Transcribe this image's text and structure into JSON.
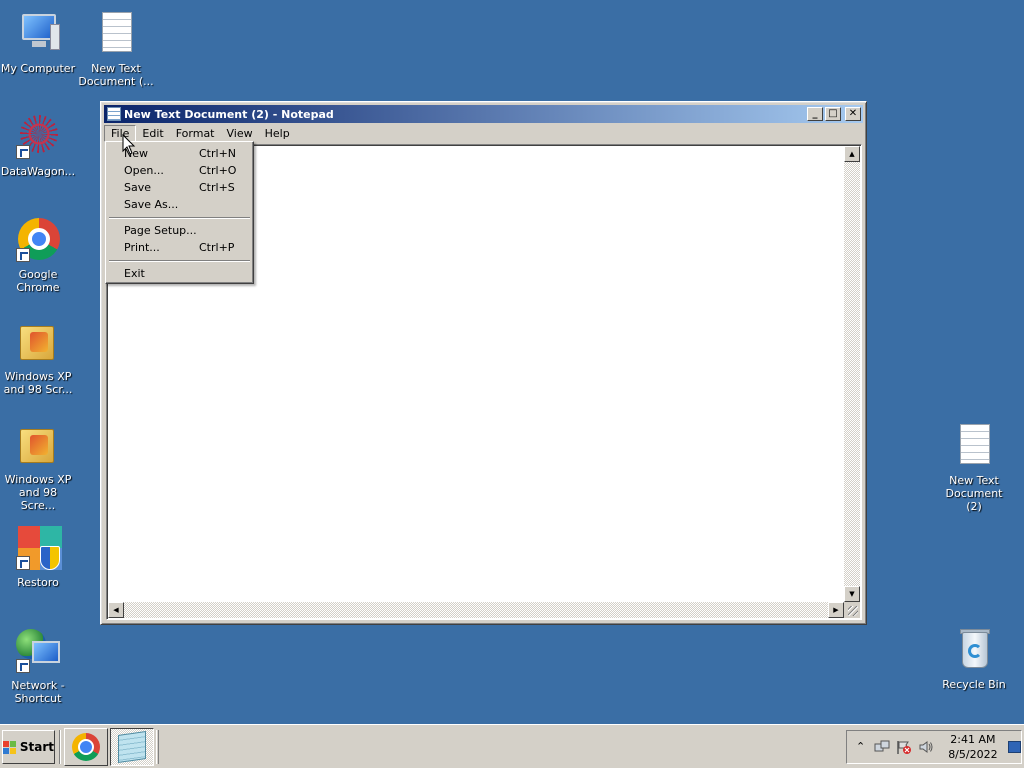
{
  "desktop": {
    "icons": [
      {
        "label": "My Computer"
      },
      {
        "label": "New Text Document (..."
      },
      {
        "label": "DataWagon..."
      },
      {
        "label": "Google Chrome"
      },
      {
        "label": "Windows XP and 98 Scr..."
      },
      {
        "label": "Windows XP and 98 Scre..."
      },
      {
        "label": "Restoro"
      },
      {
        "label": "Network - Shortcut"
      },
      {
        "label": "New Text Document (2)"
      },
      {
        "label": "Recycle Bin"
      }
    ],
    "background_color": "#3a6ea5"
  },
  "window": {
    "title": "New Text Document (2) - Notepad",
    "minimize_glyph": "_",
    "maximize_glyph": "□",
    "close_glyph": "✕",
    "menu": [
      "File",
      "Edit",
      "Format",
      "View",
      "Help"
    ],
    "active_menu": "File",
    "content": ""
  },
  "file_menu": {
    "items": [
      {
        "label": "New",
        "shortcut": "Ctrl+N"
      },
      {
        "label": "Open...",
        "shortcut": "Ctrl+O"
      },
      {
        "label": "Save",
        "shortcut": "Ctrl+S"
      },
      {
        "label": "Save As...",
        "shortcut": ""
      },
      {
        "label": "Page Setup...",
        "shortcut": ""
      },
      {
        "label": "Print...",
        "shortcut": "Ctrl+P"
      },
      {
        "label": "Exit",
        "shortcut": ""
      }
    ]
  },
  "taskbar": {
    "start_label": "Start",
    "tray": {
      "time": "2:41 AM",
      "date": "8/5/2022"
    }
  }
}
